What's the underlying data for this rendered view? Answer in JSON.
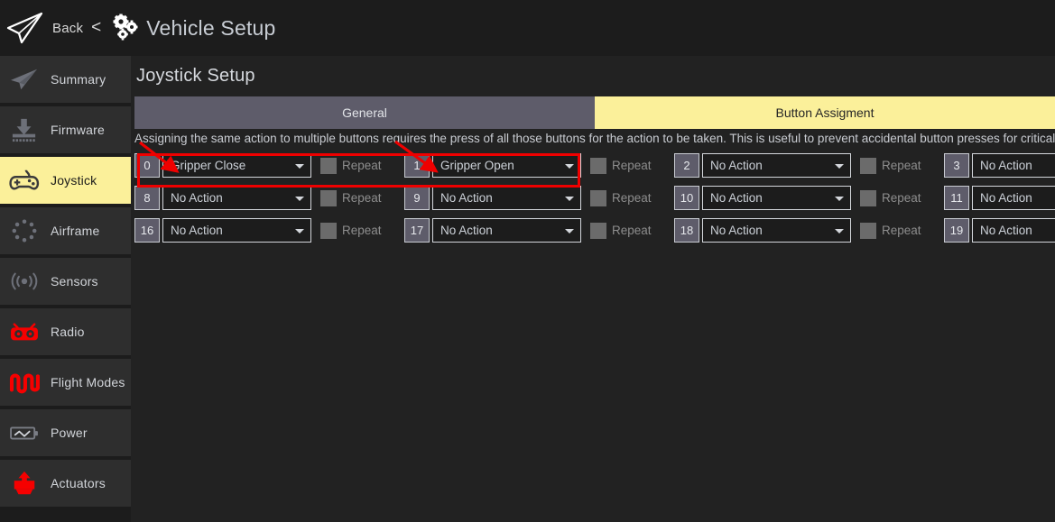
{
  "topbar": {
    "logo_icon": "paper-plane-icon",
    "back_label": "Back",
    "back_chevron": "<",
    "settings_icon": "gears-icon",
    "title": "Vehicle Setup"
  },
  "sidebar": {
    "items": [
      {
        "label": "Summary",
        "icon": "paper-plane-icon",
        "selected": false
      },
      {
        "label": "Firmware",
        "icon": "firmware-download-icon",
        "selected": false
      },
      {
        "label": "Joystick",
        "icon": "gamepad-icon",
        "selected": true
      },
      {
        "label": "Airframe",
        "icon": "airframe-dots-icon",
        "selected": false
      },
      {
        "label": "Sensors",
        "icon": "sensors-waves-icon",
        "selected": false
      },
      {
        "label": "Radio",
        "icon": "radio-icon",
        "selected": false
      },
      {
        "label": "Flight Modes",
        "icon": "flight-modes-icon",
        "selected": false
      },
      {
        "label": "Power",
        "icon": "battery-icon",
        "selected": false
      },
      {
        "label": "Actuators",
        "icon": "actuator-icon",
        "selected": false
      }
    ]
  },
  "main": {
    "panel_title": "Joystick Setup",
    "tabs": [
      {
        "label": "General",
        "active": false
      },
      {
        "label": "Button Assigment",
        "active": true
      }
    ],
    "info_text": "Assigning the same action to multiple buttons requires the press of all those buttons for the action to be taken. This is useful to prevent accidental button presses for critical act",
    "repeat_label": "Repeat",
    "button_rows": [
      [
        {
          "index": "0",
          "action": "Gripper Close",
          "repeat_checked": false,
          "show_repeat": true
        },
        {
          "index": "1",
          "action": "Gripper Open",
          "repeat_checked": false,
          "show_repeat": true
        },
        {
          "index": "2",
          "action": "No Action",
          "repeat_checked": false,
          "show_repeat": true
        },
        {
          "index": "3",
          "action": "No Action",
          "repeat_checked": false,
          "show_repeat": true
        }
      ],
      [
        {
          "index": "8",
          "action": "No Action",
          "repeat_checked": false,
          "show_repeat": true
        },
        {
          "index": "9",
          "action": "No Action",
          "repeat_checked": false,
          "show_repeat": true
        },
        {
          "index": "10",
          "action": "No Action",
          "repeat_checked": false,
          "show_repeat": true
        },
        {
          "index": "11",
          "action": "No Action",
          "repeat_checked": false,
          "show_repeat": true
        }
      ],
      [
        {
          "index": "16",
          "action": "No Action",
          "repeat_checked": false,
          "show_repeat": true
        },
        {
          "index": "17",
          "action": "No Action",
          "repeat_checked": false,
          "show_repeat": true
        },
        {
          "index": "18",
          "action": "No Action",
          "repeat_checked": false,
          "show_repeat": true
        },
        {
          "index": "19",
          "action": "No Action",
          "repeat_checked": false,
          "show_repeat": true
        }
      ]
    ]
  },
  "annotation": {
    "highlight_color": "#ef0000",
    "arrows": 2
  },
  "colors": {
    "accent_yellow": "#fbf09a",
    "tab_inactive": "#5e5c6a",
    "background": "#222222",
    "panel_dark": "#1c1c1c",
    "sidebar_item": "#2e2e2e",
    "red_icon": "#f60000",
    "annotation_red": "#ef0000"
  }
}
